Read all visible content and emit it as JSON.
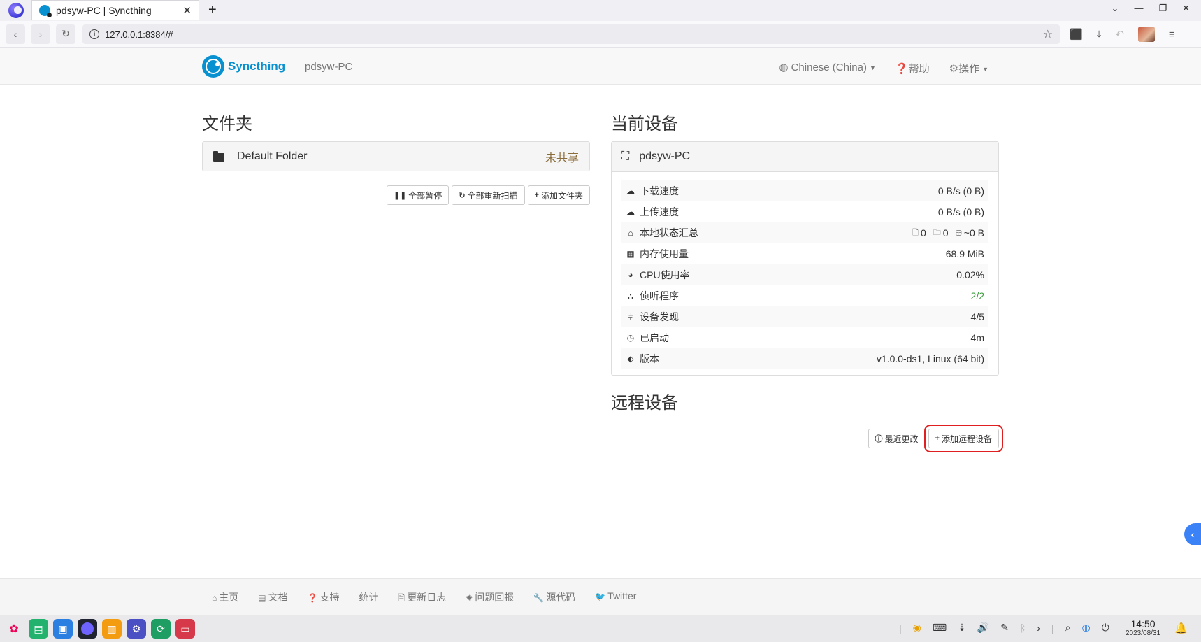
{
  "browser": {
    "tab_title": "pdsyw-PC | Syncthing",
    "tab_close": "✕",
    "new_tab": "+",
    "url": "127.0.0.1:8384/#"
  },
  "header": {
    "brand": "Syncthing",
    "device_name": "pdsyw-PC",
    "language": "Chinese (China)",
    "help": "帮助",
    "actions": "操作"
  },
  "folders": {
    "title": "文件夹",
    "items": [
      {
        "name": "Default Folder",
        "status": "未共享"
      }
    ],
    "buttons": {
      "pause_all": "全部暂停",
      "rescan_all": "全部重新扫描",
      "add_folder": "添加文件夹"
    }
  },
  "this_device": {
    "title": "当前设备",
    "name": "pdsyw-PC",
    "rows": [
      {
        "label": "下载速度",
        "value": "0 B/s (0 B)"
      },
      {
        "label": "上传速度",
        "value": "0 B/s (0 B)"
      },
      {
        "label": "本地状态汇总",
        "files": "0",
        "dirs": "0",
        "size": "~0 B"
      },
      {
        "label": "内存使用量",
        "value": "68.9 MiB"
      },
      {
        "label": "CPU使用率",
        "value": "0.02%"
      },
      {
        "label": "侦听程序",
        "value": "2/2"
      },
      {
        "label": "设备发现",
        "value": "4/5"
      },
      {
        "label": "已启动",
        "value": "4m"
      },
      {
        "label": "版本",
        "value": "v1.0.0-ds1, Linux (64 bit)"
      }
    ]
  },
  "remote_devices": {
    "title": "远程设备",
    "buttons": {
      "recent_changes": "最近更改",
      "add_remote": "添加远程设备"
    }
  },
  "footer": {
    "links": [
      "主页",
      "文档",
      "支持",
      "统计",
      "更新日志",
      "问题回报",
      "源代码",
      "Twitter"
    ]
  },
  "taskbar": {
    "time": "14:50",
    "date": "2023/08/31"
  },
  "colors": {
    "brand": "#0891d1",
    "warning_text": "#8a6d3b",
    "success_text": "#3c9b3c",
    "highlight_outline": "#e02020"
  }
}
